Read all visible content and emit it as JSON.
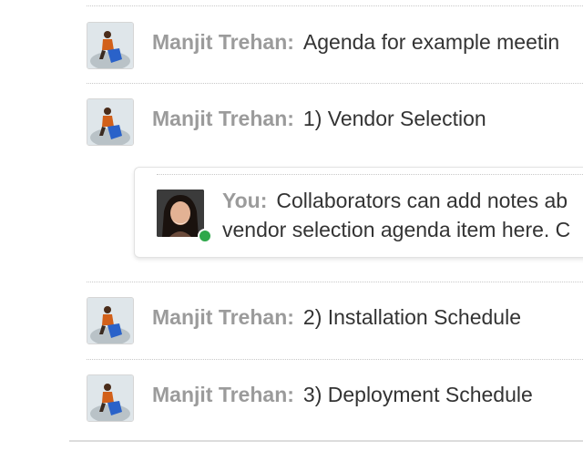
{
  "feed": {
    "posts": [
      {
        "author": "Manjit Trehan:",
        "text": "Agenda for example meetin",
        "avatar_icon": "user-avatar-icon"
      },
      {
        "author": "Manjit Trehan:",
        "text": "1) Vendor Selection",
        "avatar_icon": "user-avatar-icon"
      },
      {
        "author": "Manjit Trehan:",
        "text": "2) Installation Schedule",
        "avatar_icon": "user-avatar-icon"
      },
      {
        "author": "Manjit Trehan:",
        "text": "3) Deployment Schedule",
        "avatar_icon": "user-avatar-icon"
      }
    ],
    "reply": {
      "author": "You:",
      "line1": "Collaborators can add notes ab",
      "line2": "vendor selection agenda item here. C",
      "status": "online",
      "status_color": "#2ea84a"
    }
  }
}
